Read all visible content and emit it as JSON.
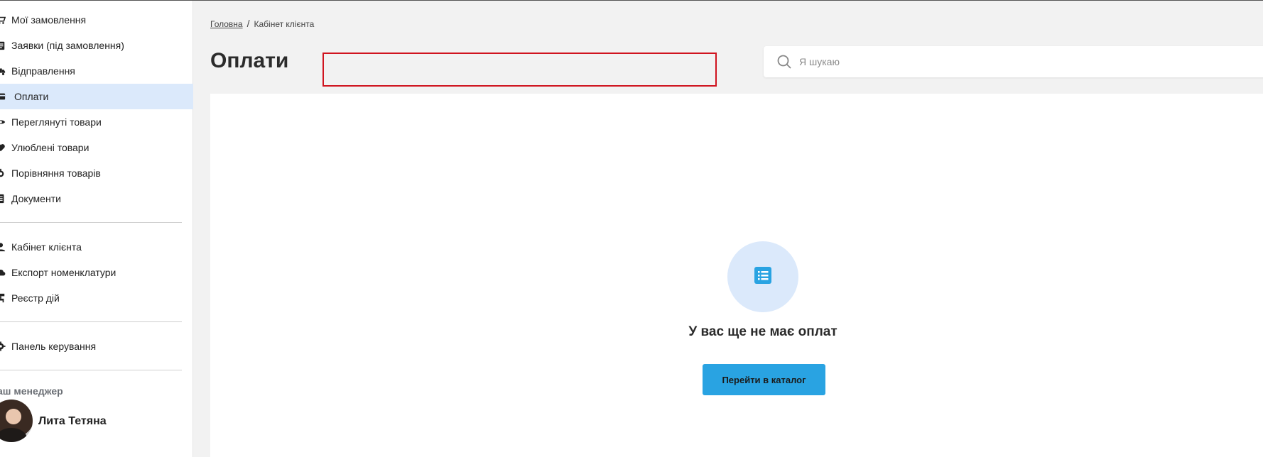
{
  "sidebar": {
    "group1": [
      {
        "label": "Мої замовлення",
        "icon": "cart-icon"
      },
      {
        "label": "Заявки (під замовлення)",
        "icon": "clipboard-icon"
      },
      {
        "label": "Відправлення",
        "icon": "truck-icon"
      },
      {
        "label": "Оплати",
        "icon": "credit-card-icon",
        "active": true
      },
      {
        "label": "Переглянуті товари",
        "icon": "eye-icon"
      },
      {
        "label": "Улюблені товари",
        "icon": "heart-icon"
      },
      {
        "label": "Порівняння товарів",
        "icon": "scale-icon"
      },
      {
        "label": "Документи",
        "icon": "document-icon"
      }
    ],
    "group2": [
      {
        "label": "Кабінет клієнта",
        "icon": "user-icon"
      },
      {
        "label": "Експорт номенклатури",
        "icon": "cloud-export-icon"
      },
      {
        "label": "Реєстр дій",
        "icon": "sitemap-icon"
      }
    ],
    "group3": [
      {
        "label": "Панель керування",
        "icon": "gear-icon"
      }
    ],
    "manager": {
      "label": "аш менеджер",
      "name": "Лита Тетяна"
    }
  },
  "breadcrumb": {
    "home": "Головна",
    "separator": "/",
    "current": "Кабінет клієнта"
  },
  "page": {
    "title": "Оплати"
  },
  "search": {
    "placeholder": "Я шукаю",
    "value": ""
  },
  "empty_state": {
    "icon": "list-icon",
    "message": "У вас ще не має оплат",
    "button_label": "Перейти в каталог"
  },
  "colors": {
    "accent": "#29a3e2",
    "active_bg": "#dbe9fb",
    "highlight_border": "#d0141f"
  }
}
